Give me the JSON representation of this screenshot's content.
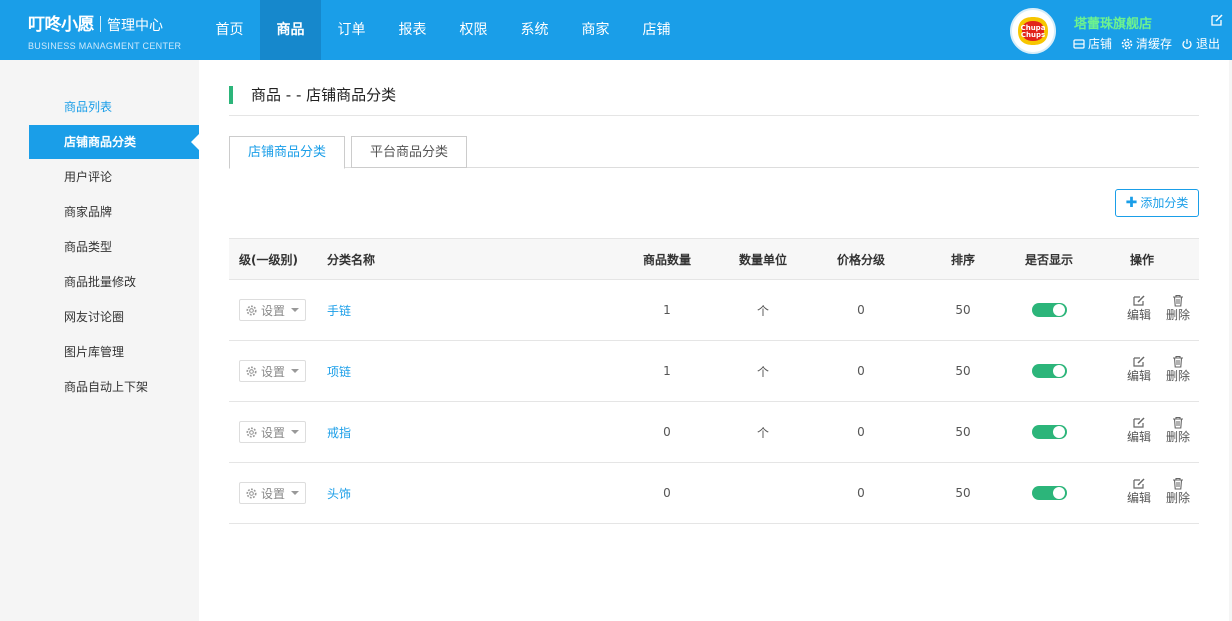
{
  "header": {
    "logo_main": "叮咚小愿",
    "logo_title": "管理中心",
    "logo_sub": "BUSINESS MANAGMENT CENTER",
    "nav": [
      "首页",
      "商品",
      "订单",
      "报表",
      "权限",
      "系统",
      "商家",
      "店铺"
    ],
    "active_nav": "商品"
  },
  "shop": {
    "name": "塔蕾珠旗舰店",
    "logo_text": [
      "Chupa",
      "Chups"
    ],
    "actions": [
      "店铺",
      "清缓存",
      "退出"
    ]
  },
  "sidebar": {
    "items": [
      "商品列表",
      "店铺商品分类",
      "用户评论",
      "商家品牌",
      "商品类型",
      "商品批量修改",
      "网友讨论圈",
      "图片库管理",
      "商品自动上下架"
    ],
    "active": "店铺商品分类"
  },
  "page": {
    "title": "商品 - - 店铺商品分类",
    "tabs": [
      "店铺商品分类",
      "平台商品分类"
    ],
    "add_button": "添加分类"
  },
  "table": {
    "headers": [
      "级(一级别)",
      "分类名称",
      "商品数量",
      "数量单位",
      "价格分级",
      "排序",
      "是否显示",
      "操作"
    ],
    "set_label": "设置",
    "edit_label": "编辑",
    "delete_label": "删除",
    "rows": [
      {
        "name": "手链",
        "count": "1",
        "unit": "个",
        "price_level": "0",
        "sort": "50",
        "visible": true
      },
      {
        "name": "项链",
        "count": "1",
        "unit": "个",
        "price_level": "0",
        "sort": "50",
        "visible": true
      },
      {
        "name": "戒指",
        "count": "0",
        "unit": "个",
        "price_level": "0",
        "sort": "50",
        "visible": true
      },
      {
        "name": "头饰",
        "count": "0",
        "unit": "",
        "price_level": "0",
        "sort": "50",
        "visible": true
      }
    ]
  },
  "colors": {
    "header_bg": "#1a9ee8",
    "nav_active": "#1688cc",
    "shop_name": "#6df28f",
    "accent_green": "#2cb57a"
  }
}
